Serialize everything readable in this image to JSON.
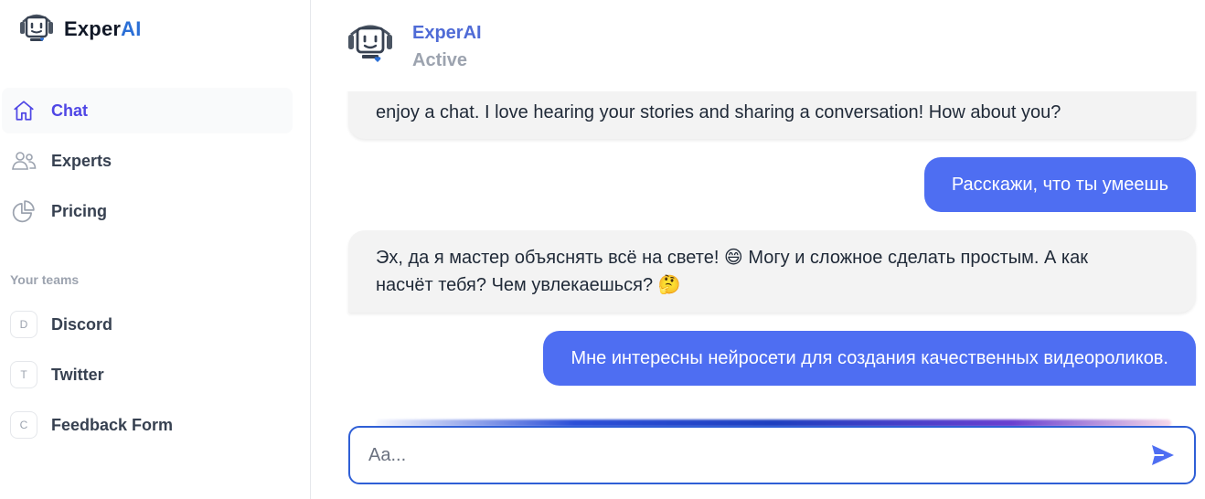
{
  "brand": {
    "part1": "Exper",
    "part2": "AI"
  },
  "nav": {
    "items": [
      {
        "label": "Chat",
        "icon": "home-icon",
        "active": true
      },
      {
        "label": "Experts",
        "icon": "users-icon",
        "active": false
      },
      {
        "label": "Pricing",
        "icon": "pie-chart-icon",
        "active": false
      }
    ]
  },
  "teams": {
    "title": "Your teams",
    "items": [
      {
        "initial": "D",
        "label": "Discord"
      },
      {
        "initial": "T",
        "label": "Twitter"
      },
      {
        "initial": "C",
        "label": "Feedback Form"
      }
    ]
  },
  "header": {
    "name": "ExperAI",
    "status": "Active"
  },
  "messages": [
    {
      "from": "bot",
      "text": "enjoy a chat. I love hearing your stories and sharing a conversation! How about you?"
    },
    {
      "from": "user",
      "text": "Расскажи, что ты умеешь"
    },
    {
      "from": "bot",
      "line1": "Эх, да я мастер объяснять всё на свете! 😄 Могу и сложное сделать простым. А как",
      "line2": "насчёт тебя? Чем увлекаешься? 🤔"
    },
    {
      "from": "user",
      "text": "Мне интересны нейросети для создания качественных видеороликов."
    }
  ],
  "composer": {
    "placeholder": "Aa...",
    "send_icon": "send-icon"
  },
  "colors": {
    "accent": "#4e6ef2",
    "active_nav": "#4f46e5",
    "brand_ai": "#2b6fd6",
    "input_border": "#2f5fd6"
  }
}
